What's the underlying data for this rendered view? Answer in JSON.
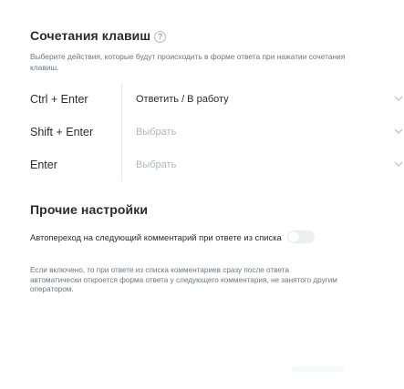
{
  "hotkeys": {
    "title": "Сочетания клавиш",
    "help_icon": "question-circle-icon",
    "description": "Выберите действия, которые будут происходить в форме ответа при нажатии сочетания клавиш.",
    "rows": [
      {
        "combo": "Ctrl + Enter",
        "value": "Ответить / В работу",
        "selected": true
      },
      {
        "combo": "Shift + Enter",
        "value": "Выбрать",
        "selected": false
      },
      {
        "combo": "Enter",
        "value": "Выбрать",
        "selected": false
      }
    ],
    "chevron_icon": "chevron-down-icon"
  },
  "other": {
    "title": "Прочие настройки",
    "autojump_label": "Автопереход на следующий комментарий при ответе из списка",
    "autojump_enabled": false,
    "autojump_description": "Если включено, то при ответе из списка комментариев сразу после ответа автоматически откроется форма ответа у следующего комментария, не занятого другим оператором."
  },
  "colors": {
    "text": "#2b2b2b",
    "secondary_text": "#707480",
    "placeholder": "#b0b4bb",
    "toggle_off": "#eceef1",
    "divider": "#e6e8ec"
  }
}
